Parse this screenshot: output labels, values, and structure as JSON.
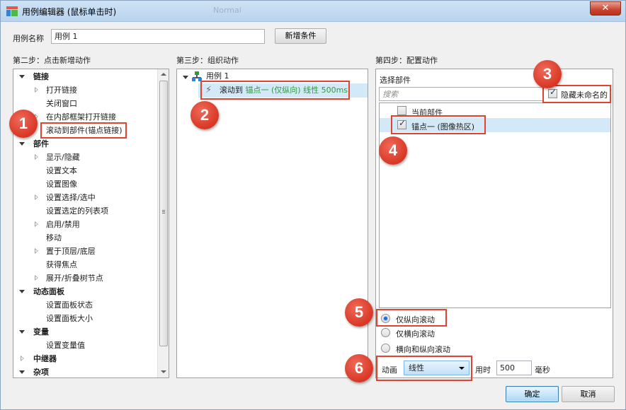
{
  "window": {
    "title": "用例编辑器 (鼠标单击时)",
    "ghost_text": "Normal",
    "close_glyph": "✕"
  },
  "case": {
    "label": "用例名称",
    "value": "用例 1",
    "add_condition_label": "新增条件"
  },
  "step2": {
    "heading": "第二步：点击新增动作",
    "items": [
      {
        "label": "链接",
        "type": "group"
      },
      {
        "label": "打开链接",
        "type": "expandable"
      },
      {
        "label": "关闭窗口",
        "type": "leaf"
      },
      {
        "label": "在内部框架打开链接",
        "type": "expandable"
      },
      {
        "label": "滚动到部件(锚点链接)",
        "type": "leaf"
      },
      {
        "label": "部件",
        "type": "group"
      },
      {
        "label": "显示/隐藏",
        "type": "expandable"
      },
      {
        "label": "设置文本",
        "type": "leaf"
      },
      {
        "label": "设置图像",
        "type": "leaf"
      },
      {
        "label": "设置选择/选中",
        "type": "expandable"
      },
      {
        "label": "设置选定的列表项",
        "type": "leaf"
      },
      {
        "label": "启用/禁用",
        "type": "expandable"
      },
      {
        "label": "移动",
        "type": "leaf"
      },
      {
        "label": "置于顶层/底层",
        "type": "expandable"
      },
      {
        "label": "获得焦点",
        "type": "leaf"
      },
      {
        "label": "展开/折叠树节点",
        "type": "expandable"
      },
      {
        "label": "动态面板",
        "type": "group"
      },
      {
        "label": "设置面板状态",
        "type": "leaf"
      },
      {
        "label": "设置面板大小",
        "type": "leaf"
      },
      {
        "label": "变量",
        "type": "group"
      },
      {
        "label": "设置变量值",
        "type": "leaf"
      },
      {
        "label": "中继器",
        "type": "collapsed-group"
      },
      {
        "label": "杂项",
        "type": "group"
      }
    ]
  },
  "step3": {
    "heading": "第三步：组织动作",
    "case_node": "用例 1",
    "action_prefix": "滚动到",
    "action_detail": "锚点一 (仅纵向) 线性 500ms"
  },
  "step4": {
    "heading": "第四步：配置动作",
    "select_widget_label": "选择部件",
    "search_placeholder": "搜索",
    "hide_unnamed_label": "隐藏未命名的",
    "hide_unnamed_checked": true,
    "widgets": [
      {
        "label": "当前部件",
        "checked": false
      },
      {
        "label": "锚点一 (图像热区)",
        "checked": true
      }
    ],
    "scroll_options": [
      {
        "label": "仅纵向滚动",
        "selected": true
      },
      {
        "label": "仅横向滚动",
        "selected": false
      },
      {
        "label": "横向和纵向滚动",
        "selected": false
      }
    ],
    "animation_label": "动画",
    "animation_value": "线性",
    "duration_label": "用时",
    "duration_value": "500",
    "duration_unit": "毫秒"
  },
  "badges": [
    "1",
    "2",
    "3",
    "4",
    "5",
    "6"
  ],
  "footer": {
    "ok_label": "确定",
    "cancel_label": "取消"
  },
  "colors": {
    "annotation_red": "#e2422f",
    "action_green": "#2e9a3d",
    "selection": "#d4e9f7"
  }
}
